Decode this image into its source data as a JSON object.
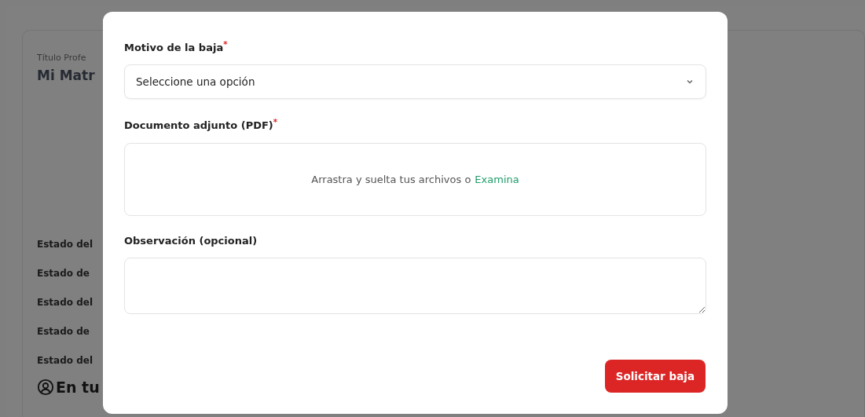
{
  "background_page": {
    "subtitle": "Título Profe",
    "title": "Mi Matr",
    "status_rows": [
      "Estado del",
      "Estado de",
      "Estado del",
      "Estado de",
      "Estado del"
    ],
    "section_heading": "En tu"
  },
  "modal": {
    "fields": [
      {
        "kind": "select",
        "label": "Motivo de la baja",
        "required_mark": "*",
        "placeholder": "Seleccione una opción"
      },
      {
        "kind": "dropzone",
        "label": "Documento adjunto (PDF)",
        "required_mark": "*",
        "hint": "Arrastra y suelta tus archivos o",
        "link": "Examina"
      },
      {
        "kind": "textarea",
        "label": "Observación (opcional)"
      }
    ],
    "submit_button": "Solicitar baja"
  }
}
